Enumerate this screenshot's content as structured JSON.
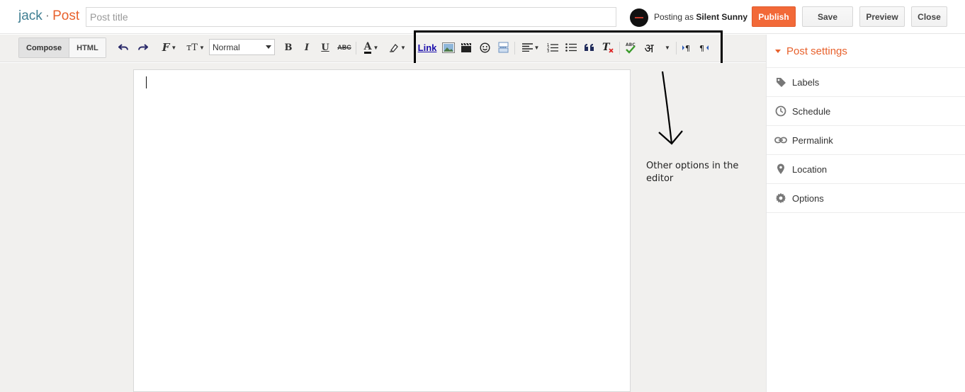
{
  "header": {
    "blog_name": "jack",
    "separator": "·",
    "section": "Post",
    "title_placeholder": "Post title",
    "posting_prefix": "Posting as",
    "author": "Silent Sunny",
    "publish_label": "Publish",
    "save_label": "Save",
    "preview_label": "Preview",
    "close_label": "Close"
  },
  "toolbar": {
    "compose_label": "Compose",
    "html_label": "HTML",
    "format_value": "Normal",
    "link_label": "Link",
    "hindi_glyph": "अ",
    "icons": [
      "undo-icon",
      "redo-icon",
      "font-family-icon",
      "font-size-icon",
      "bold-icon",
      "italic-icon",
      "underline-icon",
      "strikethrough-icon",
      "text-color-icon",
      "highlight-icon",
      "link",
      "image-icon",
      "video-icon",
      "emoji-icon",
      "jump-break-icon",
      "align-icon",
      "numbered-list-icon",
      "bulleted-list-icon",
      "quote-icon",
      "clear-format-icon",
      "spellcheck-icon",
      "transliterate-icon",
      "ltr-icon",
      "rtl-icon"
    ]
  },
  "annotation": {
    "note": "Other options in the editor"
  },
  "sidebar": {
    "heading": "Post settings",
    "items": [
      {
        "label": "Labels",
        "icon": "tag-icon"
      },
      {
        "label": "Schedule",
        "icon": "clock-icon"
      },
      {
        "label": "Permalink",
        "icon": "link-icon"
      },
      {
        "label": "Location",
        "icon": "pin-icon"
      },
      {
        "label": "Options",
        "icon": "gear-icon"
      }
    ]
  },
  "colors": {
    "accent": "#f26938",
    "brand_blog": "#3f7e92",
    "brand_post": "#e8612c"
  }
}
